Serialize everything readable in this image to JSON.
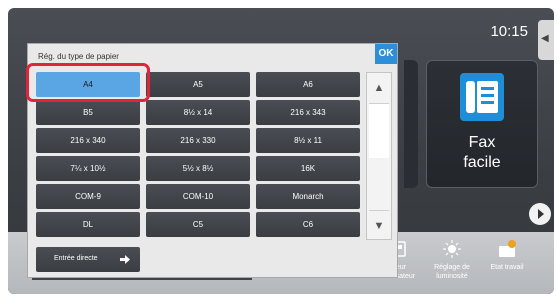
{
  "status": {
    "time": "10:15"
  },
  "home": {
    "fax_tile_label_line1": "Fax",
    "fax_tile_label_line2": "facile"
  },
  "bottom_bar": {
    "items": [
      {
        "label_line1": "pteur",
        "label_line2": "totalisateur",
        "icon": "counter-icon"
      },
      {
        "label_line1": "Réglage de",
        "label_line2": "luminosité",
        "icon": "brightness-icon"
      },
      {
        "label_line1": "Etat travail",
        "label_line2": "",
        "icon": "job-status-icon"
      }
    ],
    "toner_label": "Y"
  },
  "dialog": {
    "title": "Rég. du type de papier",
    "ok_label": "OK",
    "sizes": [
      [
        "A4",
        "A5",
        "A6"
      ],
      [
        "B5",
        "8½ x 14",
        "216 x 343"
      ],
      [
        "216 x 340",
        "216 x 330",
        "8½ x 11"
      ],
      [
        "7¼ x 10½",
        "5½ x 8½",
        "16K"
      ],
      [
        "COM-9",
        "COM-10",
        "Monarch"
      ],
      [
        "DL",
        "C5",
        "C6"
      ]
    ],
    "selected": "A4",
    "direct_entry_label": "Entrée directe"
  },
  "colors": {
    "accent": "#2d8fd8",
    "selected": "#5aa6e4",
    "highlight_outline": "#e0243c",
    "toner_yellow": "#e4de3a"
  }
}
